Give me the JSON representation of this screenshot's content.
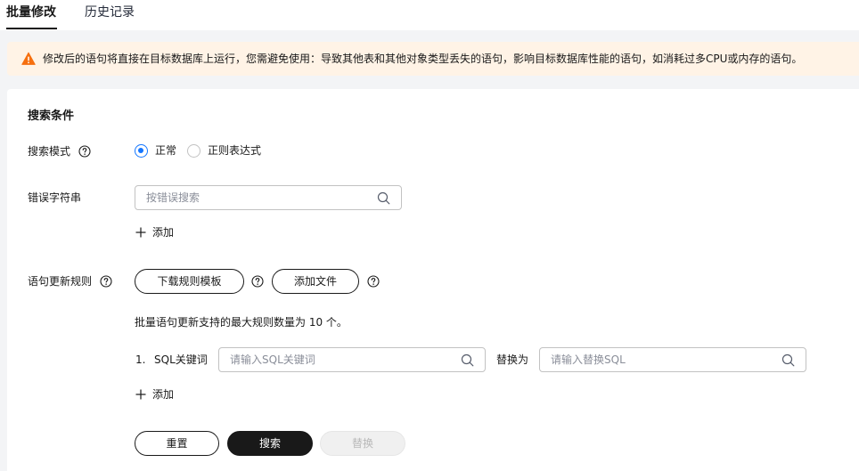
{
  "tabs": [
    {
      "label": "批量修改",
      "active": true
    },
    {
      "label": "历史记录",
      "active": false
    }
  ],
  "alert": {
    "text": "修改后的语句将直接在目标数据库上运行，您需避免使用：导致其他表和其他对象类型丢失的语句，影响目标数据库性能的语句，如消耗过多CPU或内存的语句。",
    "icon": "warning-icon",
    "color": "#f66f0f"
  },
  "search": {
    "title": "搜索条件",
    "mode_label": "搜索模式",
    "mode_options": [
      {
        "label": "正常",
        "checked": true
      },
      {
        "label": "正则表达式",
        "checked": false
      }
    ],
    "error_label": "错误字符串",
    "error_placeholder": "按错误搜索",
    "add_label": "添加"
  },
  "rules": {
    "label": "语句更新规则",
    "download_button": "下载规则模板",
    "add_file_button": "添加文件",
    "max_hint": "批量语句更新支持的最大规则数量为 10 个。",
    "items": [
      {
        "index": "1.",
        "keyword_label": "SQL关键词",
        "keyword_placeholder": "请输入SQL关键词",
        "replace_label": "替换为",
        "replace_placeholder": "请输入替换SQL"
      }
    ],
    "add_label": "添加"
  },
  "actions": {
    "reset": "重置",
    "search": "搜索",
    "replace": "替换"
  },
  "colors": {
    "accent": "#1476ff",
    "primary_button": "#191919",
    "alert_bg": "#fff3e6"
  }
}
